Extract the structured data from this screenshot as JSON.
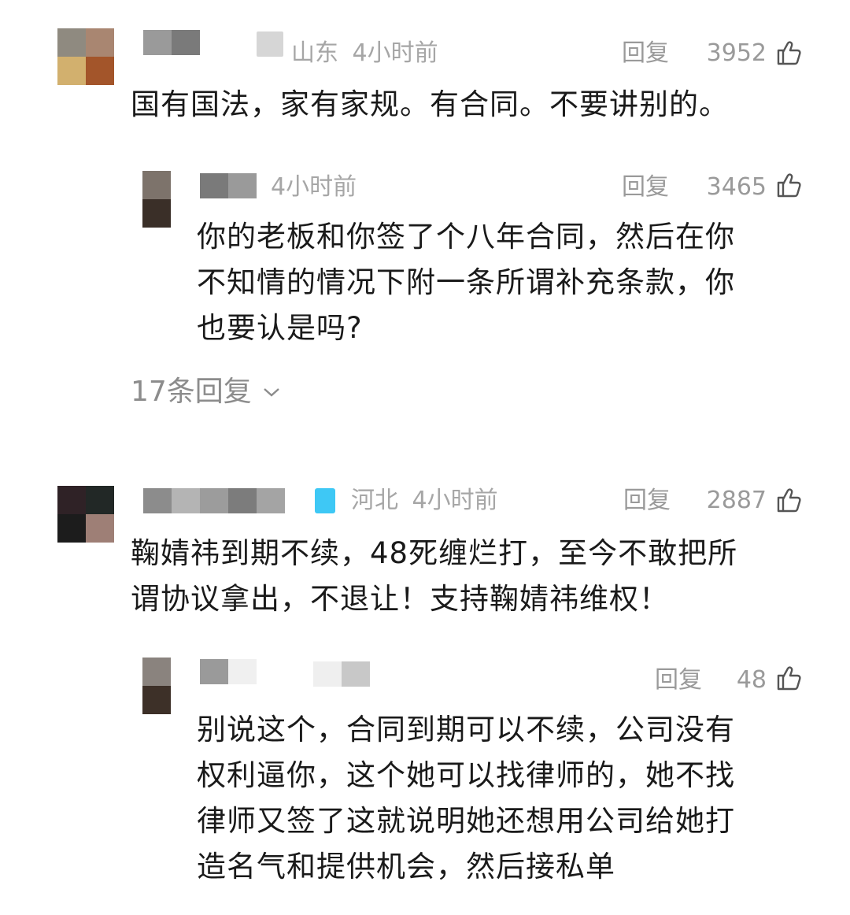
{
  "comments": [
    {
      "location": "山东",
      "time": "4小时前",
      "reply_label": "回复",
      "likes": "3952",
      "text": "国有国法，家有家规。有合同。不要讲别的。",
      "avatar_colors": [
        "#8f8a80",
        "#a98671",
        "#d2b06e",
        "#a3552a"
      ],
      "reply": {
        "time": "4小时前",
        "reply_label": "回复",
        "likes": "3465",
        "text": "你的老板和你签了个八年合同，然后在你\n不知情的情况下附一条所谓补充条款，你\n也要认是吗?",
        "avatar_colors": [
          "#7d736b",
          "#3a2f28"
        ]
      },
      "more_replies": "17条回复"
    },
    {
      "location": "河北",
      "time": "4小时前",
      "reply_label": "回复",
      "likes": "2887",
      "text": "鞠婧祎到期不续，48死缠烂打，至今不敢把所\n谓协议拿出，不退让！支持鞠婧祎维权！",
      "avatar_colors": [
        "#2f2226",
        "#222826",
        "#1c1c1c",
        "#9e7f76"
      ],
      "badge_color": "#3ec8f5",
      "reply": {
        "reply_label": "回复",
        "likes": "48",
        "text": "别说这个，合同到期可以不续，公司没有\n权利逼你，这个她可以找律师的，她不找\n律师又签了这就说明她还想用公司给她打\n造名气和提供机会，然后接私单",
        "avatar_colors": [
          "#8a837e",
          "#3d3028"
        ]
      }
    }
  ]
}
